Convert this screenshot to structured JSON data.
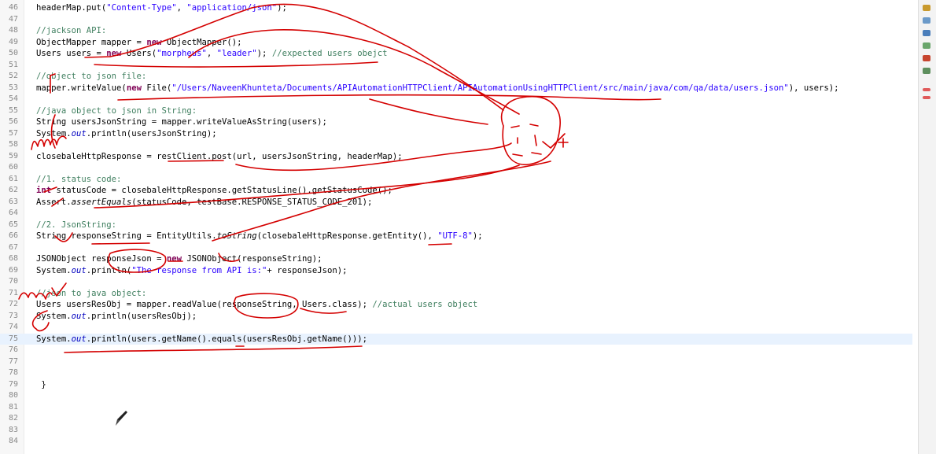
{
  "editor": {
    "lines": [
      {
        "n": "46",
        "t": "        headerMap.put(\"Content-Type\", \"application/json\");"
      },
      {
        "n": "47",
        "t": ""
      },
      {
        "n": "48",
        "t": "        //jackson API:"
      },
      {
        "n": "49",
        "t": "        ObjectMapper mapper = new ObjectMapper();"
      },
      {
        "n": "50",
        "t": "        Users users = new Users(\"morpheus\", \"leader\"); //expected users obejct"
      },
      {
        "n": "51",
        "t": ""
      },
      {
        "n": "52",
        "t": "        //object to json file:"
      },
      {
        "n": "53",
        "t": "        mapper.writeValue(new File(\"/Users/NaveenKhunteta/Documents/APIAutomationHTTPClient/APIAutomationUsingHTTPClient/src/main/java/com/qa/data/users.json\"), users);"
      },
      {
        "n": "54",
        "t": ""
      },
      {
        "n": "55",
        "t": "        //java object to json in String:"
      },
      {
        "n": "56",
        "t": "        String usersJsonString = mapper.writeValueAsString(users);"
      },
      {
        "n": "57",
        "t": "        System.out.println(usersJsonString);"
      },
      {
        "n": "58",
        "t": ""
      },
      {
        "n": "59",
        "t": "        closebaleHttpResponse = restClient.post(url, usersJsonString, headerMap);"
      },
      {
        "n": "60",
        "t": ""
      },
      {
        "n": "61",
        "t": "        //1. status code:"
      },
      {
        "n": "62",
        "t": "        int statusCode = closebaleHttpResponse.getStatusLine().getStatusCode();"
      },
      {
        "n": "63",
        "t": "        Assert.assertEquals(statusCode, testBase.RESPONSE_STATUS_CODE_201);"
      },
      {
        "n": "64",
        "t": ""
      },
      {
        "n": "65",
        "t": "        //2. JsonString:"
      },
      {
        "n": "66",
        "t": "        String responseString = EntityUtils.toString(closebaleHttpResponse.getEntity(), \"UTF-8\");"
      },
      {
        "n": "67",
        "t": ""
      },
      {
        "n": "68",
        "t": "        JSONObject responseJson = new JSONObject(responseString);"
      },
      {
        "n": "69",
        "t": "        System.out.println(\"The response from API is:\"+ responseJson);"
      },
      {
        "n": "70",
        "t": ""
      },
      {
        "n": "71",
        "t": "        //json to java object:"
      },
      {
        "n": "72",
        "t": "        Users usersResObj = mapper.readValue(responseString, Users.class); //actual users object"
      },
      {
        "n": "73",
        "t": "        System.out.println(usersResObj);"
      },
      {
        "n": "74",
        "t": ""
      },
      {
        "n": "75",
        "t": "        System.out.println(users.getName().equals(usersResObj.getName()));"
      },
      {
        "n": "76",
        "t": ""
      },
      {
        "n": "77",
        "t": ""
      },
      {
        "n": "78",
        "t": ""
      },
      {
        "n": "79",
        "t": "    }"
      },
      {
        "n": "80",
        "t": ""
      },
      {
        "n": "81",
        "t": ""
      },
      {
        "n": "82",
        "t": ""
      },
      {
        "n": "83",
        "t": ""
      },
      {
        "n": "84",
        "t": ""
      }
    ],
    "current_line": "75"
  },
  "annotation_color": "#d40000",
  "ruler_icons": [
    "task-icon",
    "marker-icon",
    "error-icon",
    "warning-icon",
    "bookmark-icon"
  ]
}
